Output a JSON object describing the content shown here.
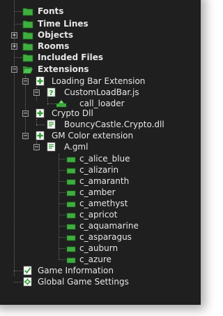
{
  "tree": {
    "fonts": "Fonts",
    "time_lines": "Time Lines",
    "objects": "Objects",
    "rooms": "Rooms",
    "included_files": "Included Files",
    "extensions": "Extensions",
    "loading_bar_extension": "Loading Bar Extension",
    "custom_load_bar": "CustomLoadBar.js",
    "call_loader": "call_loader",
    "crypto_dll": "Crypto Dll",
    "bouncy_castle": "BouncyCastle.Crypto.dll",
    "gm_color_extension": "GM Color extension",
    "a_gml": "A.gml",
    "functions": [
      "c_alice_blue",
      "c_alizarin",
      "c_amaranth",
      "c_amber",
      "c_amethyst",
      "c_apricot",
      "c_aquamarine",
      "c_asparagus",
      "c_auburn",
      "c_azure"
    ],
    "game_information": "Game Information",
    "global_game_settings": "Global Game Settings"
  },
  "icons": {
    "folder": "folder-icon",
    "extension": "extension-package-icon",
    "script_unknown": "question-mark-icon",
    "script_file": "script-file-icon",
    "function": "function-icon",
    "game_information": "game-information-icon",
    "global_game_settings": "settings-icon"
  },
  "colors": {
    "background": "#1f1f1f",
    "folder_green": "#3fae3f",
    "text": "#e6e6e6"
  }
}
